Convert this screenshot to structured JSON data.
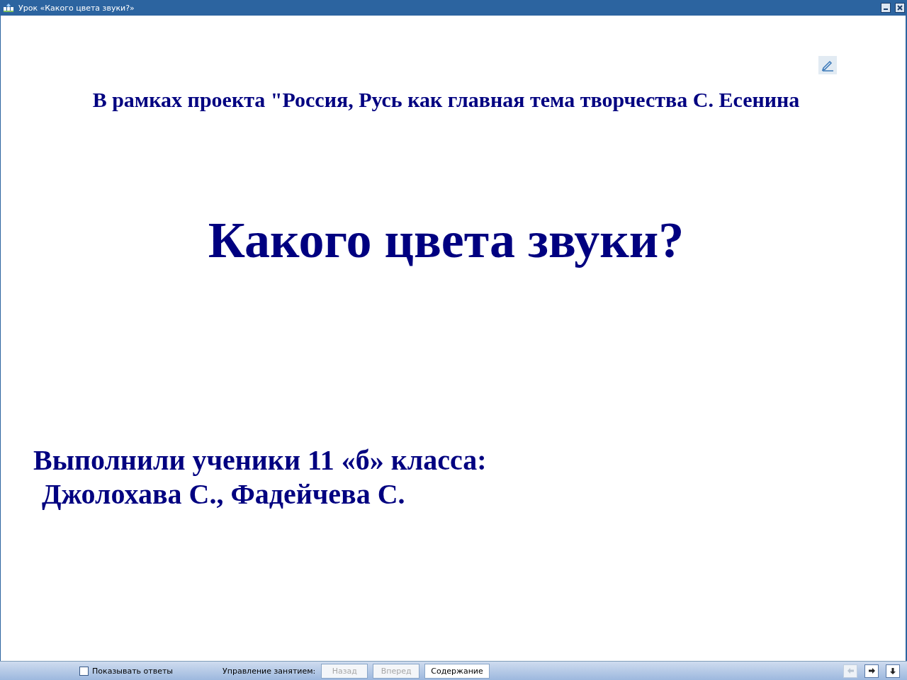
{
  "window": {
    "title": "Урок «Какого цвета звуки?»"
  },
  "slide": {
    "subtitle": "В рамках проекта \"Россия, Русь как главная тема творчества С. Есенина",
    "title": "Какого цвета звуки?",
    "authors": [
      "Выполнили ученики 11 «б» класса:",
      "Джолохава С., Фадейчева С."
    ]
  },
  "status_bar": {
    "show_answers": {
      "label": "Показывать ответы",
      "checked": false
    },
    "control_label": "Управление занятием:",
    "buttons": [
      {
        "label": "Назад",
        "disabled": true
      },
      {
        "label": "Вперед",
        "disabled": true
      },
      {
        "label": "Содержание",
        "disabled": false
      }
    ],
    "nav": [
      {
        "kind": "left",
        "disabled": true
      },
      {
        "kind": "right",
        "disabled": false
      },
      {
        "kind": "down",
        "disabled": false
      }
    ]
  }
}
